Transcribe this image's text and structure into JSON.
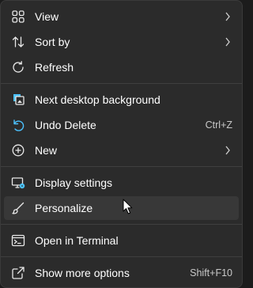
{
  "menu": {
    "view": {
      "label": "View",
      "icon": "grid-icon"
    },
    "sort_by": {
      "label": "Sort by",
      "icon": "sort-arrows-icon"
    },
    "refresh": {
      "label": "Refresh",
      "icon": "refresh-icon"
    },
    "next_background": {
      "label": "Next desktop background",
      "icon": "desktop-background-icon"
    },
    "undo_delete": {
      "label": "Undo Delete",
      "shortcut": "Ctrl+Z",
      "icon": "undo-icon"
    },
    "new": {
      "label": "New",
      "icon": "plus-circle-icon"
    },
    "display_settings": {
      "label": "Display settings",
      "icon": "display-settings-icon"
    },
    "personalize": {
      "label": "Personalize",
      "icon": "brush-icon"
    },
    "open_terminal": {
      "label": "Open in Terminal",
      "icon": "terminal-icon"
    },
    "show_more": {
      "label": "Show more options",
      "shortcut": "Shift+F10",
      "icon": "share-icon"
    }
  },
  "colors": {
    "background": "#2b2b2b",
    "text": "#ffffff",
    "hover": "#383838",
    "accent": "#4cc2ff"
  }
}
